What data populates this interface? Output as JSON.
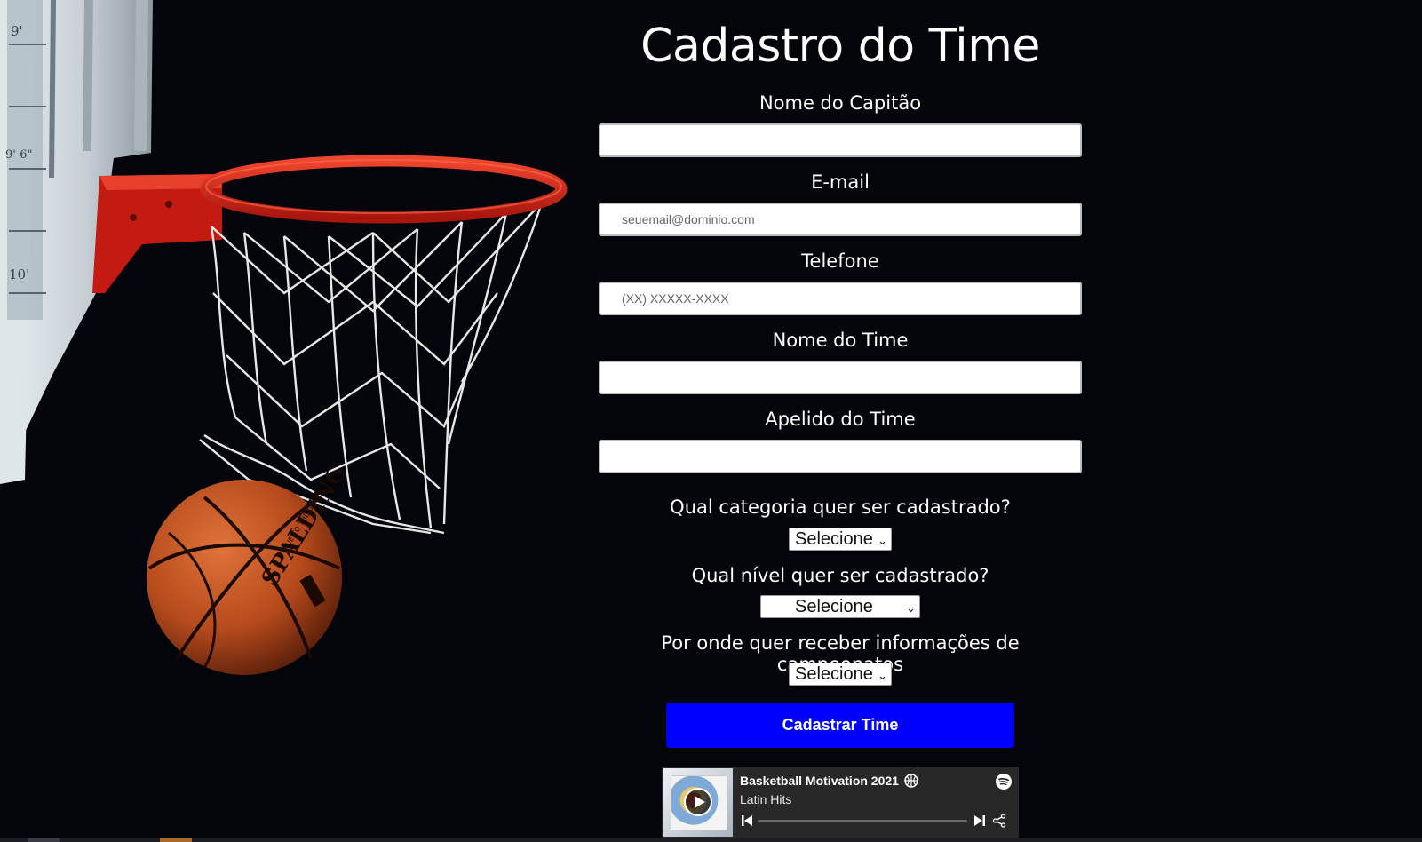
{
  "illustration": {
    "backboard_marks": [
      "9'",
      "9'-6\"",
      "10'"
    ],
    "ball_brand": "SPALDING",
    "ball_tagline": "TRUE TO THE GAME"
  },
  "form": {
    "title": "Cadastro do Time",
    "fields": [
      {
        "label": "Nome do Capitão",
        "value": "",
        "placeholder": ""
      },
      {
        "label": "E-mail",
        "value": "",
        "placeholder": "seuemail@dominio.com"
      },
      {
        "label": "Telefone",
        "value": "",
        "placeholder": "(XX) XXXXX-XXXX"
      },
      {
        "label": "Nome do Time",
        "value": "",
        "placeholder": ""
      },
      {
        "label": "Apelido do Time",
        "value": "",
        "placeholder": ""
      }
    ],
    "selects": [
      {
        "question": "Qual categoria quer ser cadastrado?",
        "selected": "Selecione"
      },
      {
        "question": "Qual nível quer ser cadastrado?",
        "selected": "Selecione"
      },
      {
        "question": "Por onde quer receber informações de campeonatos",
        "selected": "Selecione"
      }
    ],
    "submit_label": "Cadastrar Time"
  },
  "player": {
    "track_title": "Basketball Motivation 2021",
    "artist": "Latin Hits",
    "progress": 0.0,
    "icons": [
      "play-icon",
      "basketball-emoji-icon",
      "spotify-logo-icon",
      "previous-track-icon",
      "next-track-icon",
      "share-icon"
    ]
  },
  "colors": {
    "background": "#04050a",
    "submit_button": "#0000ff",
    "rim": "#d9261c",
    "ball": "#c4521f",
    "player_bg": "#282828"
  }
}
